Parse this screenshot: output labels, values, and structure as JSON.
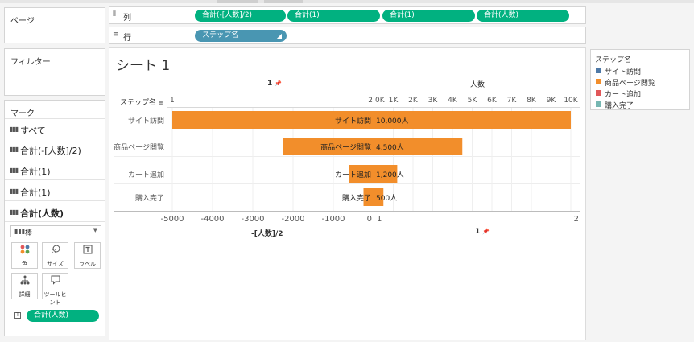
{
  "pages_label": "ページ",
  "filters_label": "フィルター",
  "marks": {
    "title": "マーク",
    "rows": [
      "すべて",
      "合計(-[人数]/2)",
      "合計(1)",
      "合計(1)",
      "合計(人数)"
    ],
    "mark_type": "棒",
    "buttons": [
      {
        "icon": "dots-icon",
        "label": "色"
      },
      {
        "icon": "size-icon",
        "label": "サイズ"
      },
      {
        "icon": "label-icon",
        "label": "ラベル"
      },
      {
        "icon": "detail-icon",
        "label": "詳細"
      },
      {
        "icon": "tooltip-icon",
        "label": "ツールヒント"
      }
    ],
    "label_pill": "合計(人数)"
  },
  "columns_shelf": {
    "label": "列",
    "pills": [
      "合計(-[人数]/2)",
      "合計(1)",
      "合計(1)",
      "合計(人数)"
    ]
  },
  "rows_shelf": {
    "label": "行",
    "pills": [
      "ステップ名"
    ]
  },
  "legend": {
    "title": "ステップ名",
    "items": [
      {
        "label": "サイト訪問",
        "color": "#4e79a7"
      },
      {
        "label": "商品ページ閲覧",
        "color": "#f28e2b"
      },
      {
        "label": "カート追加",
        "color": "#e15759"
      },
      {
        "label": "購入完了",
        "color": "#76b7b2"
      }
    ]
  },
  "viz": {
    "sheet_title": "シート 1",
    "row_header": "ステップ名",
    "left_header": "1",
    "right_header": "人数",
    "bottom_left_title": "-[人数]/2",
    "bottom_right_title": "1"
  },
  "chart_data": {
    "type": "bar",
    "categories": [
      "サイト訪問",
      "商品ページ閲覧",
      "カート追加",
      "購入完了"
    ],
    "values": [
      10000,
      4500,
      1200,
      500
    ],
    "value_labels": [
      "10,000人",
      "4,500人",
      "1,200人",
      "500人"
    ],
    "left_axis": {
      "ticks": [
        "-5000",
        "-4000",
        "-3000",
        "-2000",
        "-1000",
        "0"
      ],
      "range": [
        -5270,
        0
      ]
    },
    "top_left_axis": {
      "ticks": [
        "1",
        "2"
      ]
    },
    "right_axis": {
      "ticks": [
        "0K",
        "1K",
        "2K",
        "3K",
        "4K",
        "5K",
        "6K",
        "7K",
        "8K",
        "9K",
        "10K"
      ],
      "range": [
        0,
        10200
      ]
    },
    "bottom_right_axis": {
      "ticks": [
        "1",
        "2"
      ]
    },
    "color": "#f28e2b"
  }
}
